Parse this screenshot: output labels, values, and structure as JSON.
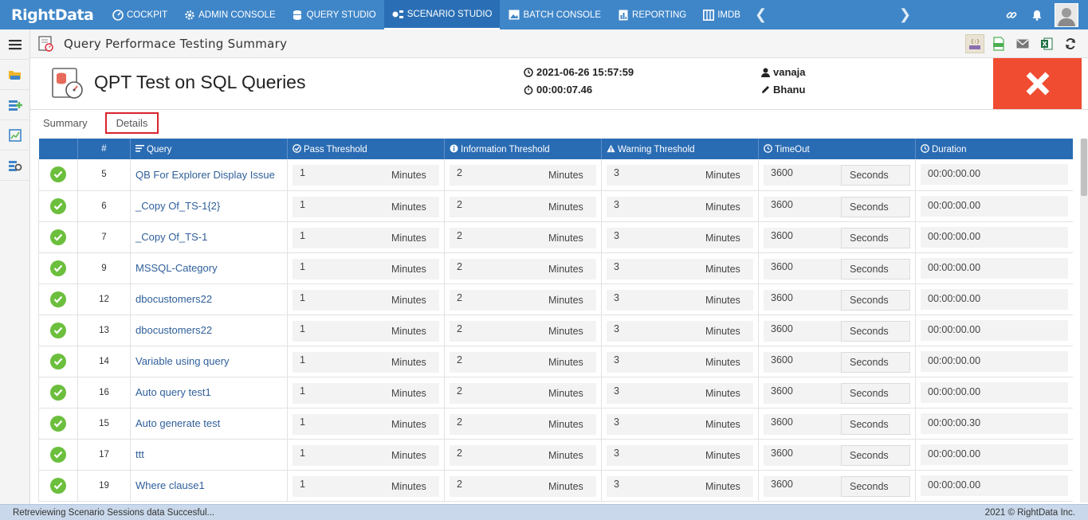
{
  "nav": {
    "brand": "RightData",
    "items": [
      {
        "label": "COCKPIT",
        "icon": "dashboard-icon",
        "active": false
      },
      {
        "label": "ADMIN CONSOLE",
        "icon": "gear-icon",
        "active": false
      },
      {
        "label": "QUERY STUDIO",
        "icon": "database-icon",
        "active": false
      },
      {
        "label": "SCENARIO STUDIO",
        "icon": "scenario-icon",
        "active": true
      },
      {
        "label": "BATCH CONSOLE",
        "icon": "image-icon",
        "active": false
      },
      {
        "label": "REPORTING",
        "icon": "report-icon",
        "active": false
      },
      {
        "label": "IMDB",
        "icon": "columns-icon",
        "active": false
      }
    ]
  },
  "page": {
    "title": "Query Performace Testing Summary"
  },
  "scenario": {
    "title": "QPT Test on SQL Queries",
    "datetime": "2021-06-26 15:57:59",
    "elapsed": "00:00:07.46",
    "user": "vanaja",
    "editor": "Bhanu"
  },
  "tabs": [
    {
      "label": "Summary",
      "selected": false
    },
    {
      "label": "Details",
      "selected": true
    }
  ],
  "table": {
    "headers": {
      "num": "#",
      "query": "Query",
      "pass": "Pass Threshold",
      "info": "Information Threshold",
      "warn": "Warning Threshold",
      "timeout": "TimeOut",
      "duration": "Duration"
    },
    "rows": [
      {
        "num": "5",
        "query": "QB For Explorer Display Issue",
        "pass": "1",
        "pass_unit": "Minutes",
        "info": "2",
        "info_unit": "Minutes",
        "warn": "3",
        "warn_unit": "Minutes",
        "timeout": "3600",
        "timeout_unit": "Seconds",
        "duration": "00:00:00.00"
      },
      {
        "num": "6",
        "query": "_Copy Of_TS-1{2}",
        "pass": "1",
        "pass_unit": "Minutes",
        "info": "2",
        "info_unit": "Minutes",
        "warn": "3",
        "warn_unit": "Minutes",
        "timeout": "3600",
        "timeout_unit": "Seconds",
        "duration": "00:00:00.00"
      },
      {
        "num": "7",
        "query": "_Copy Of_TS-1",
        "pass": "1",
        "pass_unit": "Minutes",
        "info": "2",
        "info_unit": "Minutes",
        "warn": "3",
        "warn_unit": "Minutes",
        "timeout": "3600",
        "timeout_unit": "Seconds",
        "duration": "00:00:00.00"
      },
      {
        "num": "9",
        "query": "MSSQL-Category",
        "pass": "1",
        "pass_unit": "Minutes",
        "info": "2",
        "info_unit": "Minutes",
        "warn": "3",
        "warn_unit": "Minutes",
        "timeout": "3600",
        "timeout_unit": "Seconds",
        "duration": "00:00:00.00"
      },
      {
        "num": "12",
        "query": "dbocustomers22",
        "pass": "1",
        "pass_unit": "Minutes",
        "info": "2",
        "info_unit": "Minutes",
        "warn": "3",
        "warn_unit": "Minutes",
        "timeout": "3600",
        "timeout_unit": "Seconds",
        "duration": "00:00:00.00"
      },
      {
        "num": "13",
        "query": "dbocustomers22",
        "pass": "1",
        "pass_unit": "Minutes",
        "info": "2",
        "info_unit": "Minutes",
        "warn": "3",
        "warn_unit": "Minutes",
        "timeout": "3600",
        "timeout_unit": "Seconds",
        "duration": "00:00:00.00"
      },
      {
        "num": "14",
        "query": "Variable using query",
        "pass": "1",
        "pass_unit": "Minutes",
        "info": "2",
        "info_unit": "Minutes",
        "warn": "3",
        "warn_unit": "Minutes",
        "timeout": "3600",
        "timeout_unit": "Seconds",
        "duration": "00:00:00.00"
      },
      {
        "num": "16",
        "query": "Auto query test1",
        "pass": "1",
        "pass_unit": "Minutes",
        "info": "2",
        "info_unit": "Minutes",
        "warn": "3",
        "warn_unit": "Minutes",
        "timeout": "3600",
        "timeout_unit": "Seconds",
        "duration": "00:00:00.00"
      },
      {
        "num": "15",
        "query": "Auto generate test",
        "pass": "1",
        "pass_unit": "Minutes",
        "info": "2",
        "info_unit": "Minutes",
        "warn": "3",
        "warn_unit": "Minutes",
        "timeout": "3600",
        "timeout_unit": "Seconds",
        "duration": "00:00:00.30"
      },
      {
        "num": "17",
        "query": "ttt",
        "pass": "1",
        "pass_unit": "Minutes",
        "info": "2",
        "info_unit": "Minutes",
        "warn": "3",
        "warn_unit": "Minutes",
        "timeout": "3600",
        "timeout_unit": "Seconds",
        "duration": "00:00:00.00"
      },
      {
        "num": "19",
        "query": "Where clause1",
        "pass": "1",
        "pass_unit": "Minutes",
        "info": "2",
        "info_unit": "Minutes",
        "warn": "3",
        "warn_unit": "Minutes",
        "timeout": "3600",
        "timeout_unit": "Seconds",
        "duration": "00:00:00.00"
      }
    ]
  },
  "status": {
    "message": "Retreviewing Scenario Sessions data Succesful...",
    "copyright": "2021 © RightData Inc."
  },
  "colors": {
    "nav": "#3f86c8",
    "table_header": "#2a6cb3",
    "close": "#f04c32",
    "ok": "#6cbf3d"
  }
}
